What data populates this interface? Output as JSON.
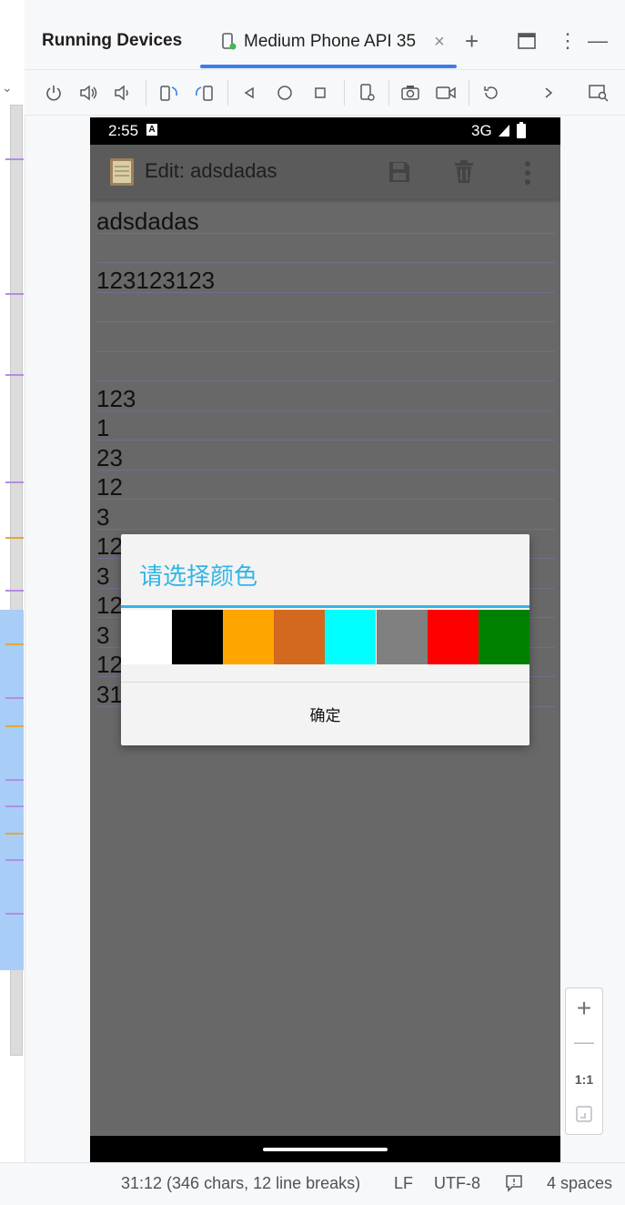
{
  "tool_window": {
    "title": "Running Devices",
    "tab_label": "Medium Phone API 35",
    "tab_close": "×",
    "add_tab": "+",
    "minimize": "—",
    "more": "⋮"
  },
  "toolbar": {
    "icons": [
      "power-icon",
      "volume-up-icon",
      "volume-down-icon",
      "rotate-left-icon",
      "rotate-right-icon",
      "back-icon",
      "home-icon",
      "overview-icon",
      "device-settings-icon",
      "screenshot-icon",
      "screen-record-icon",
      "reset-icon",
      "more-chevron-icon",
      "mirror-window-icon"
    ]
  },
  "device": {
    "status_bar": {
      "time": "2:55",
      "network": "3G"
    },
    "app_bar": {
      "title": "Edit: adsdadas"
    },
    "note_lines": [
      "adsdadas",
      "",
      "123123123",
      "",
      "",
      "",
      "123",
      "1",
      "23",
      "12",
      "3",
      "12",
      "3",
      "12",
      "3",
      "12",
      "31"
    ]
  },
  "dialog": {
    "title": "请选择颜色",
    "colors": [
      "#ffffff",
      "#000000",
      "#ffa500",
      "#d2691e",
      "#00ffff",
      "#808080",
      "#ff0000",
      "#008000"
    ],
    "ok_label": "确定"
  },
  "zoom_controls": {
    "zoom_in": "+",
    "zoom_out": "—",
    "actual_size": "1:1"
  },
  "status_bar": {
    "position": "31:12 (346 chars, 12 line breaks)",
    "line_separator": "LF",
    "encoding": "UTF-8",
    "indent": "4 spaces"
  },
  "colors": {
    "accent_blue": "#3c7cf0",
    "dialog_accent": "#33b5e5"
  }
}
